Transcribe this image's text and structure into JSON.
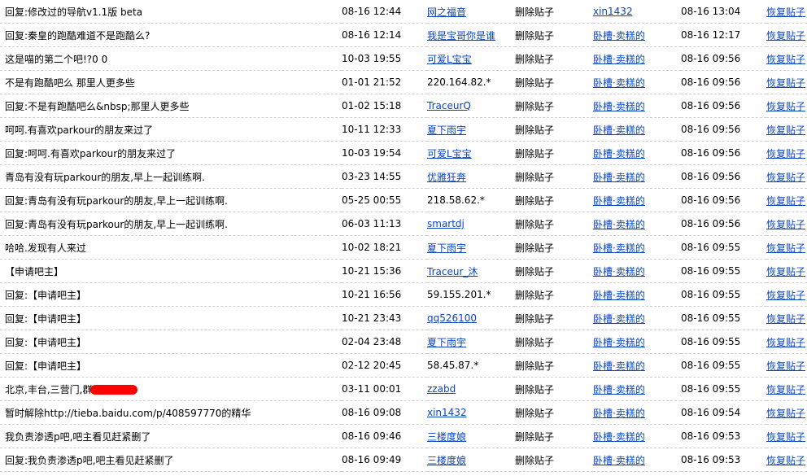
{
  "link_color": "#0b46c2",
  "action_label": "删除贴子",
  "restore_label": "恢复贴子",
  "rows": [
    {
      "title": "回复:修改过的导航v1.1版 beta",
      "time": "08-16 12:44",
      "author": "网之福音",
      "author_link": true,
      "operator": "xin1432",
      "op_time": "08-16 13:04"
    },
    {
      "title": "回复:秦皇的跑酷难道不是跑酷么?",
      "time": "08-16 12:14",
      "author": "我是宝哥你是谁",
      "author_link": true,
      "operator": "卧槽·卖糕的",
      "op_time": "08-16 12:17"
    },
    {
      "title": "这是喵的第二个吧!?0 0",
      "time": "10-03 19:55",
      "author": "可爱L宝宝",
      "author_link": true,
      "operator": "卧槽·卖糕的",
      "op_time": "08-16 09:56"
    },
    {
      "title": "不是有跑酷吧么 那里人更多些",
      "time": "01-01 21:52",
      "author": "220.164.82.*",
      "author_link": false,
      "operator": "卧槽·卖糕的",
      "op_time": "08-16 09:56"
    },
    {
      "title": "回复:不是有跑酷吧么&nbsp;那里人更多些",
      "time": "01-02 15:18",
      "author": "TraceurQ",
      "author_link": true,
      "operator": "卧槽·卖糕的",
      "op_time": "08-16 09:56"
    },
    {
      "title": "呵呵.有喜欢parkour的朋友来过了",
      "time": "10-11 12:33",
      "author": "夏下雨宇",
      "author_link": true,
      "operator": "卧槽·卖糕的",
      "op_time": "08-16 09:56"
    },
    {
      "title": "回复:呵呵.有喜欢parkour的朋友来过了",
      "time": "10-03 19:54",
      "author": "可爱L宝宝",
      "author_link": true,
      "operator": "卧槽·卖糕的",
      "op_time": "08-16 09:56"
    },
    {
      "title": "青岛有没有玩parkour的朋友,早上一起训练啊.",
      "time": "03-23 14:55",
      "author": "优雅狂奔",
      "author_link": true,
      "operator": "卧槽·卖糕的",
      "op_time": "08-16 09:56"
    },
    {
      "title": "回复:青岛有没有玩parkour的朋友,早上一起训练啊.",
      "time": "05-25 00:55",
      "author": "218.58.62.*",
      "author_link": false,
      "operator": "卧槽·卖糕的",
      "op_time": "08-16 09:56"
    },
    {
      "title": "回复:青岛有没有玩parkour的朋友,早上一起训练啊.",
      "time": "06-03 11:13",
      "author": "smartdj",
      "author_link": true,
      "operator": "卧槽·卖糕的",
      "op_time": "08-16 09:56"
    },
    {
      "title": "哈哈.发现有人来过",
      "time": "10-02 18:21",
      "author": "夏下雨宇",
      "author_link": true,
      "operator": "卧槽·卖糕的",
      "op_time": "08-16 09:55"
    },
    {
      "title": "【申请吧主】",
      "time": "10-21 15:36",
      "author": "Traceur_沐",
      "author_link": true,
      "operator": "卧槽·卖糕的",
      "op_time": "08-16 09:55"
    },
    {
      "title": "回复:【申请吧主】",
      "time": "10-21 16:56",
      "author": "59.155.201.*",
      "author_link": false,
      "operator": "卧槽·卖糕的",
      "op_time": "08-16 09:55"
    },
    {
      "title": "回复:【申请吧主】",
      "time": "10-21 23:43",
      "author": "qq526100",
      "author_link": true,
      "operator": "卧槽·卖糕的",
      "op_time": "08-16 09:55"
    },
    {
      "title": "回复:【申请吧主】",
      "time": "02-04 23:48",
      "author": "夏下雨宇",
      "author_link": true,
      "operator": "卧槽·卖糕的",
      "op_time": "08-16 09:55"
    },
    {
      "title": "回复:【申请吧主】",
      "time": "02-12 20:45",
      "author": "58.45.87.*",
      "author_link": false,
      "operator": "卧槽·卖糕的",
      "op_time": "08-16 09:55"
    },
    {
      "title": "北京,丰台,三营门,群",
      "redacted": true,
      "time": "03-11 00:01",
      "author": "zzabd",
      "author_link": true,
      "operator": "卧槽·卖糕的",
      "op_time": "08-16 09:55"
    },
    {
      "title": "暂时解除http://tieba.baidu.com/p/408597770的精华",
      "time": "08-16 09:08",
      "author": "xin1432",
      "author_link": true,
      "operator": "卧槽·卖糕的",
      "op_time": "08-16 09:54"
    },
    {
      "title": "我负责渗透p吧,吧主看见赶紧删了",
      "time": "08-16 09:46",
      "author": "三楼度娘",
      "author_link": true,
      "operator": "卧槽·卖糕的",
      "op_time": "08-16 09:53"
    },
    {
      "title": "回复:我负责渗透p吧,吧主看见赶紧删了",
      "time": "08-16 09:49",
      "author": "三楼度娘",
      "author_link": true,
      "operator": "卧槽·卖糕的",
      "op_time": "08-16 09:53"
    }
  ]
}
